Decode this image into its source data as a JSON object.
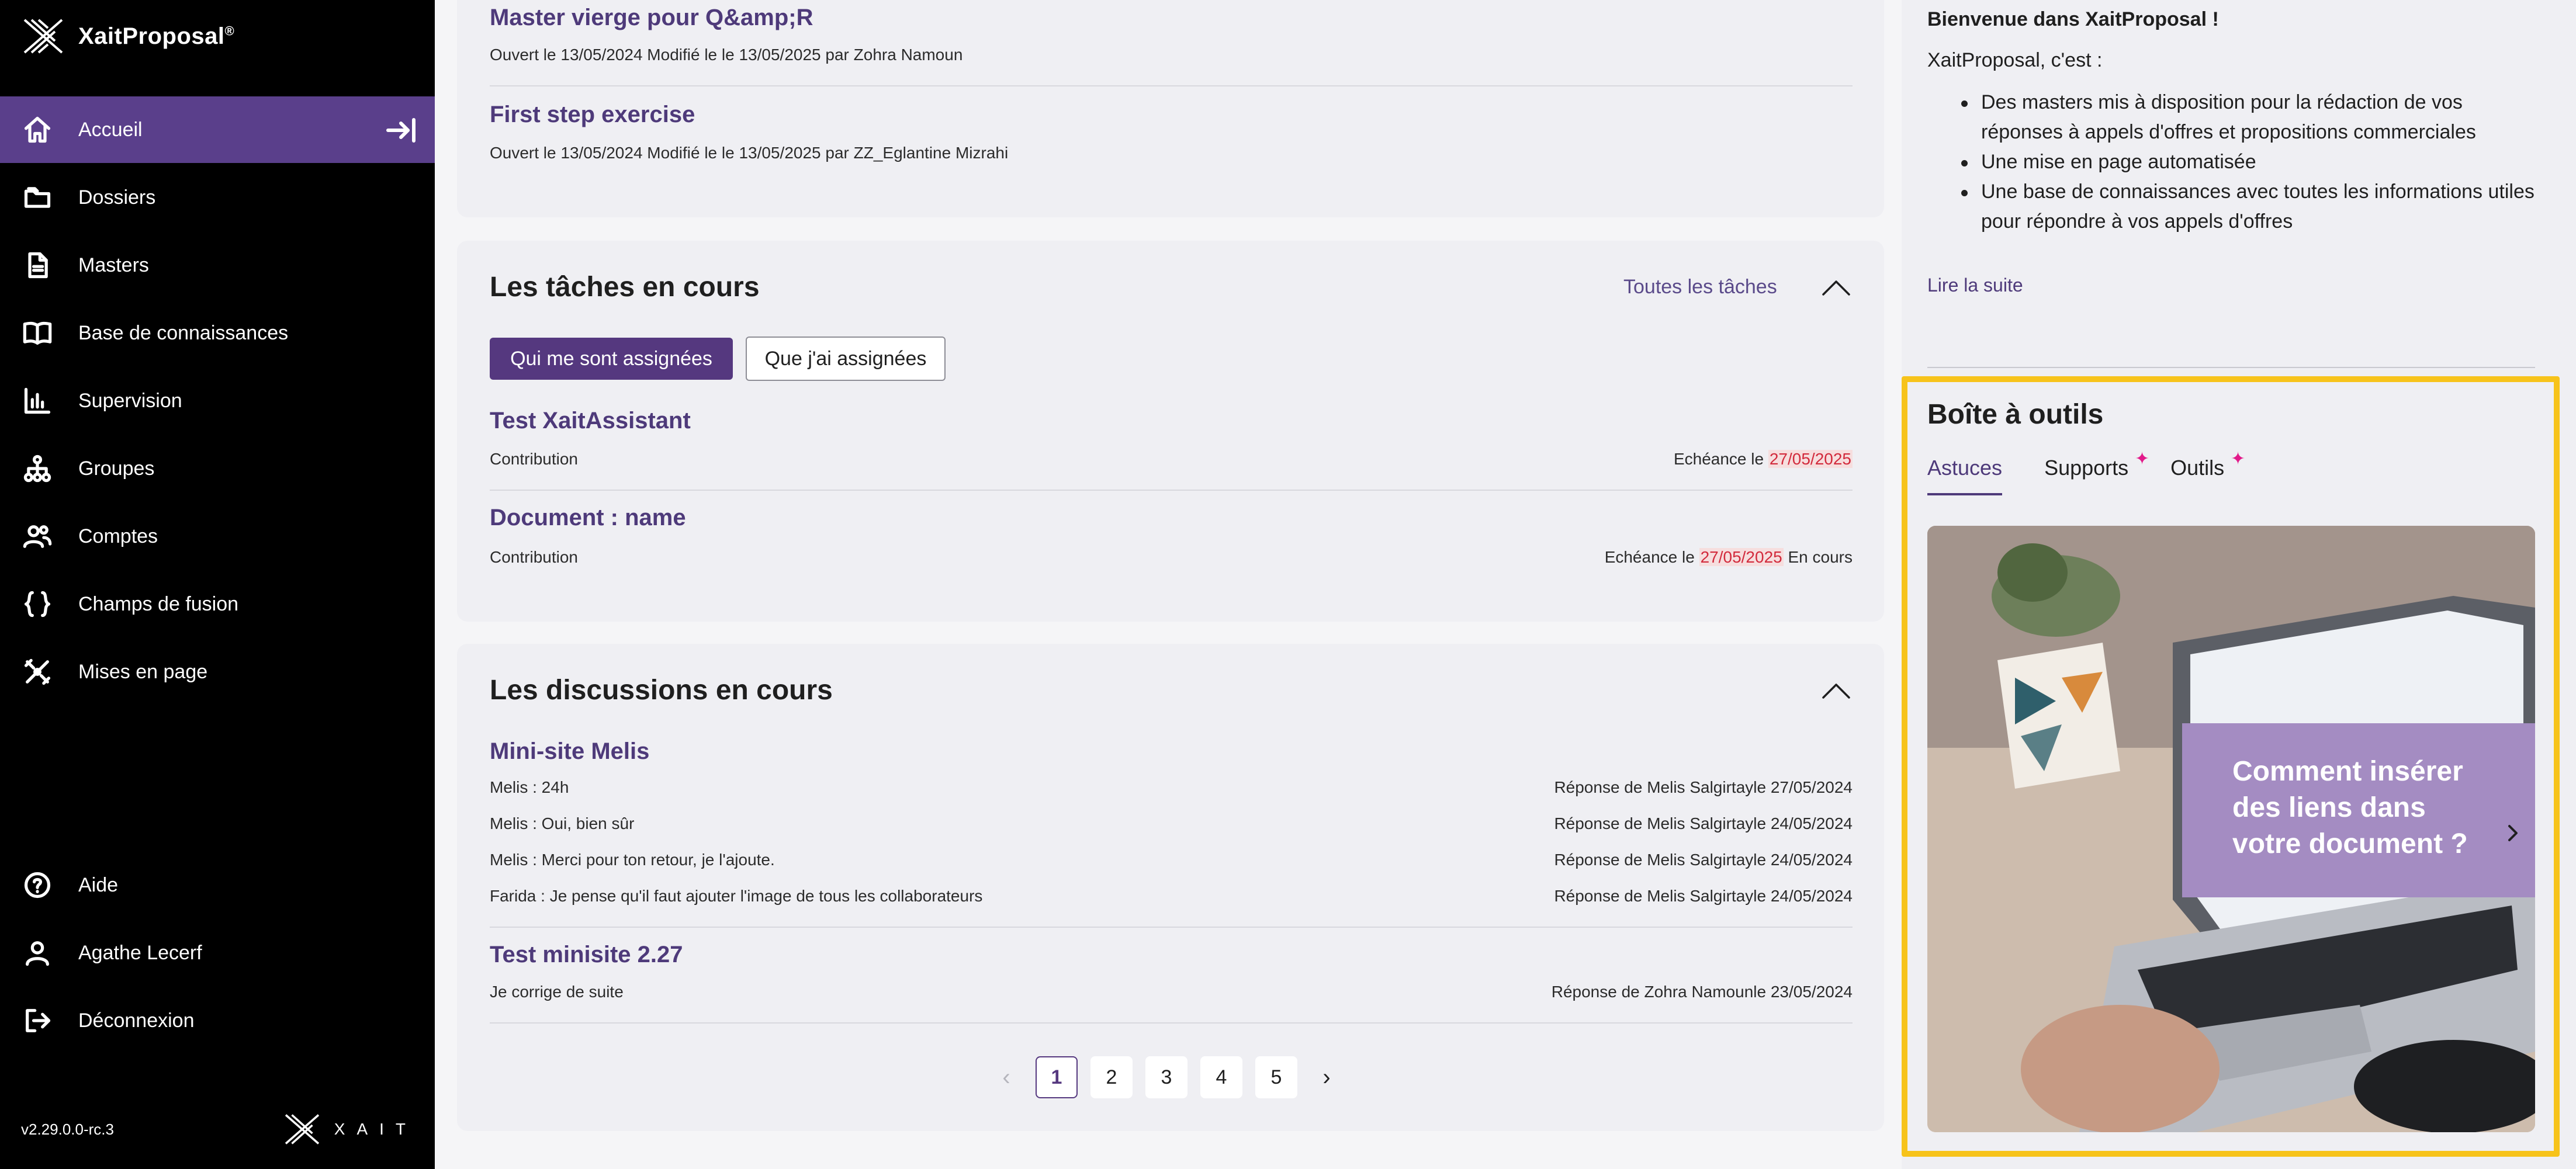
{
  "app": {
    "brand": "XaitProposal",
    "brand_mark": "®",
    "version": "v2.29.0.0-rc.3",
    "footer_brand": "XAIT"
  },
  "colors": {
    "accent": "#55387f",
    "active_nav": "#5a3f8b",
    "highlight_frame": "#f7c31b",
    "due_date": "#d22a3c",
    "sparkle": "#e21a8a"
  },
  "sidebar": {
    "items": [
      {
        "label": "Accueil",
        "icon": "home-icon",
        "active": true
      },
      {
        "label": "Dossiers",
        "icon": "folders-icon"
      },
      {
        "label": "Masters",
        "icon": "document-icon"
      },
      {
        "label": "Base de connaissances",
        "icon": "book-icon"
      },
      {
        "label": "Supervision",
        "icon": "bar-chart-icon"
      },
      {
        "label": "Groupes",
        "icon": "hierarchy-icon"
      },
      {
        "label": "Comptes",
        "icon": "users-icon"
      },
      {
        "label": "Champs de fusion",
        "icon": "braces-icon"
      },
      {
        "label": "Mises en page",
        "icon": "layout-tools-icon"
      }
    ],
    "bottom_items": [
      {
        "label": "Aide",
        "icon": "help-icon"
      },
      {
        "label": "Agathe Lecerf",
        "icon": "user-icon"
      },
      {
        "label": "Déconnexion",
        "icon": "logout-icon"
      }
    ]
  },
  "recent": {
    "items": [
      {
        "title": "Master vierge pour Q&amp;R",
        "meta": "Ouvert le 13/05/2024   Modifié le le 13/05/2025 par Zohra Namoun"
      },
      {
        "title": "First step exercise",
        "meta": "Ouvert le 13/05/2024   Modifié le le 13/05/2025 par ZZ_Eglantine Mizrahi"
      }
    ]
  },
  "tasks": {
    "title": "Les tâches en cours",
    "all_link": "Toutes les tâches",
    "filter_assigned_to_me": "Qui me sont assignées",
    "filter_assigned_by_me": "Que j'ai assignées",
    "items": [
      {
        "title": "Test XaitAssistant",
        "type": "Contribution",
        "due_prefix": "Echéance le ",
        "due_date": "27/05/2025",
        "status": ""
      },
      {
        "title": "Document : name",
        "type": "Contribution",
        "due_prefix": "Echéance le ",
        "due_date": "27/05/2025",
        "status": " En cours"
      }
    ]
  },
  "discussions": {
    "title": "Les discussions en cours",
    "threads": [
      {
        "title": "Mini-site Melis",
        "messages": [
          {
            "text": "Melis : 24h",
            "reply": "Réponse de Melis Salgirtayle 27/05/2024"
          },
          {
            "text": "Melis : Oui, bien sûr",
            "reply": "Réponse de Melis Salgirtayle 24/05/2024"
          },
          {
            "text": "Melis : Merci pour ton retour, je l'ajoute.",
            "reply": "Réponse de Melis Salgirtayle 24/05/2024"
          },
          {
            "text": "Farida : Je pense qu'il faut ajouter l'image de tous les collaborateurs",
            "reply": "Réponse de Melis Salgirtayle 24/05/2024"
          }
        ]
      },
      {
        "title": "Test minisite 2.27",
        "messages": [
          {
            "text": "Je corrige de suite",
            "reply": "Réponse de Zohra Namounle 23/05/2024"
          }
        ]
      }
    ],
    "pagination": {
      "prev": "‹",
      "next": "›",
      "pages": [
        "1",
        "2",
        "3",
        "4",
        "5"
      ],
      "current": "1"
    }
  },
  "welcome": {
    "title": "Bienvenue dans XaitProposal !",
    "intro": "XaitProposal, c'est :",
    "bullets": [
      "Des masters mis à disposition pour la rédaction de vos réponses à appels d'offres et propositions commerciales",
      "Une mise en page automatisée",
      "Une base de connaissances avec toutes les informations utiles pour répondre à vos appels d'offres"
    ],
    "read_more": "Lire la suite"
  },
  "toolbox": {
    "title": "Boîte à outils",
    "tabs": [
      {
        "label": "Astuces",
        "active": true,
        "new": false
      },
      {
        "label": "Supports",
        "active": false,
        "new": true
      },
      {
        "label": "Outils",
        "active": false,
        "new": true
      }
    ],
    "new_marker": "✦",
    "promo": {
      "text": "Comment insérer des liens dans votre document ?",
      "image_description_icon": "laptop-photo"
    }
  }
}
